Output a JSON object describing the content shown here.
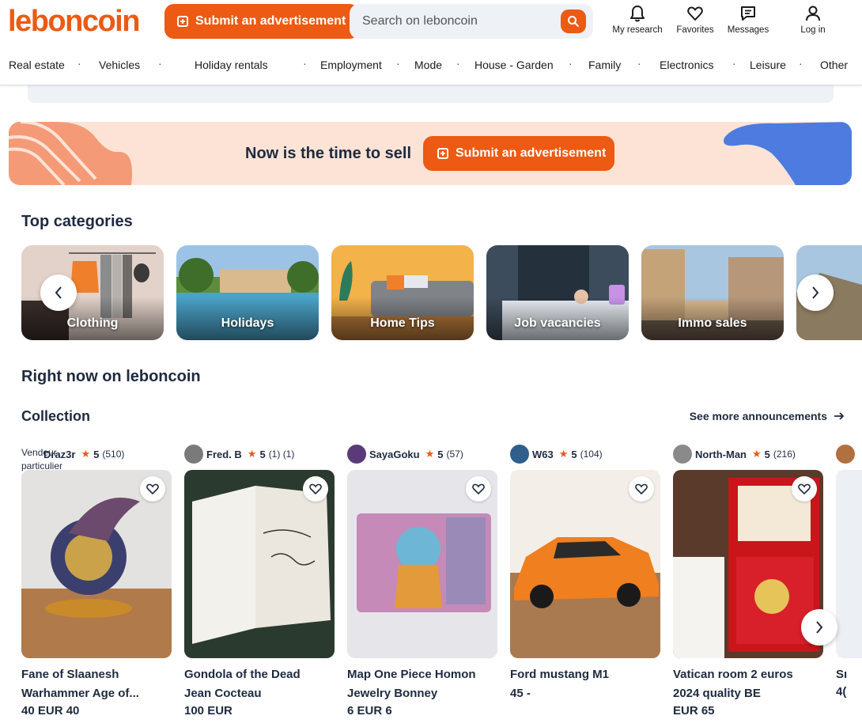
{
  "header": {
    "logo": "leboncoin",
    "submit_label": "Submit an advertisement",
    "search_placeholder": "Search on leboncoin",
    "actions": [
      {
        "label": "My research",
        "icon": "bell-icon"
      },
      {
        "label": "Favorites",
        "icon": "heart-icon"
      },
      {
        "label": "Messages",
        "icon": "message-icon"
      },
      {
        "label": "Log in",
        "icon": "user-icon"
      }
    ],
    "categories": [
      "Real estate",
      "Vehicles",
      "Holiday rentals",
      "Employment",
      "Mode",
      "House - Garden",
      "Family",
      "Electronics",
      "Leisure",
      "Other"
    ],
    "separator": "·"
  },
  "sell_banner": {
    "text": "Now is the time to sell",
    "button_label": "Submit an advertisement"
  },
  "top_categories": {
    "title": "Top categories",
    "items": [
      "Clothing",
      "Holidays",
      "Home Tips",
      "Job vacancies",
      "Immo sales"
    ]
  },
  "right_now": {
    "title": "Right now on leboncoin"
  },
  "collection": {
    "title": "Collection",
    "see_more": "See more announcements",
    "listings": [
      {
        "seller": "Draz3r",
        "seller_overlay": "Vendeur particulier",
        "rating": "5",
        "count": "(510)",
        "title_line1": "Fane of Slaanesh",
        "title_line2": "Warhammer Age of...",
        "price": "40 EUR 40"
      },
      {
        "seller": "Fred. B",
        "rating": "5",
        "count": "(1) (1)",
        "title_line1": "Gondola of the Dead",
        "title_line2": "Jean Cocteau",
        "price": "100 EUR"
      },
      {
        "seller": "SayaGoku",
        "rating": "5",
        "count": "(57)",
        "title_line1": "Map One Piece Homon",
        "title_line2": "Jewelry Bonney",
        "price": "6 EUR 6"
      },
      {
        "seller": "W63",
        "rating": "5",
        "count": "(104)",
        "title_line1": "Ford mustang M1",
        "title_line2": "",
        "price": "45 -"
      },
      {
        "seller": "North-Man",
        "rating": "5",
        "count": "(216)",
        "title_line1": "Vatican room 2 euros",
        "title_line2": "2024 quality BE",
        "price": "EUR 65"
      }
    ],
    "partial_title": "Sı",
    "partial_price": "4("
  },
  "colors": {
    "brand": "#ec5a13",
    "navy": "#1e2a3f",
    "banner_bg": "#fde3d6",
    "search_bg": "#eef1f6"
  }
}
